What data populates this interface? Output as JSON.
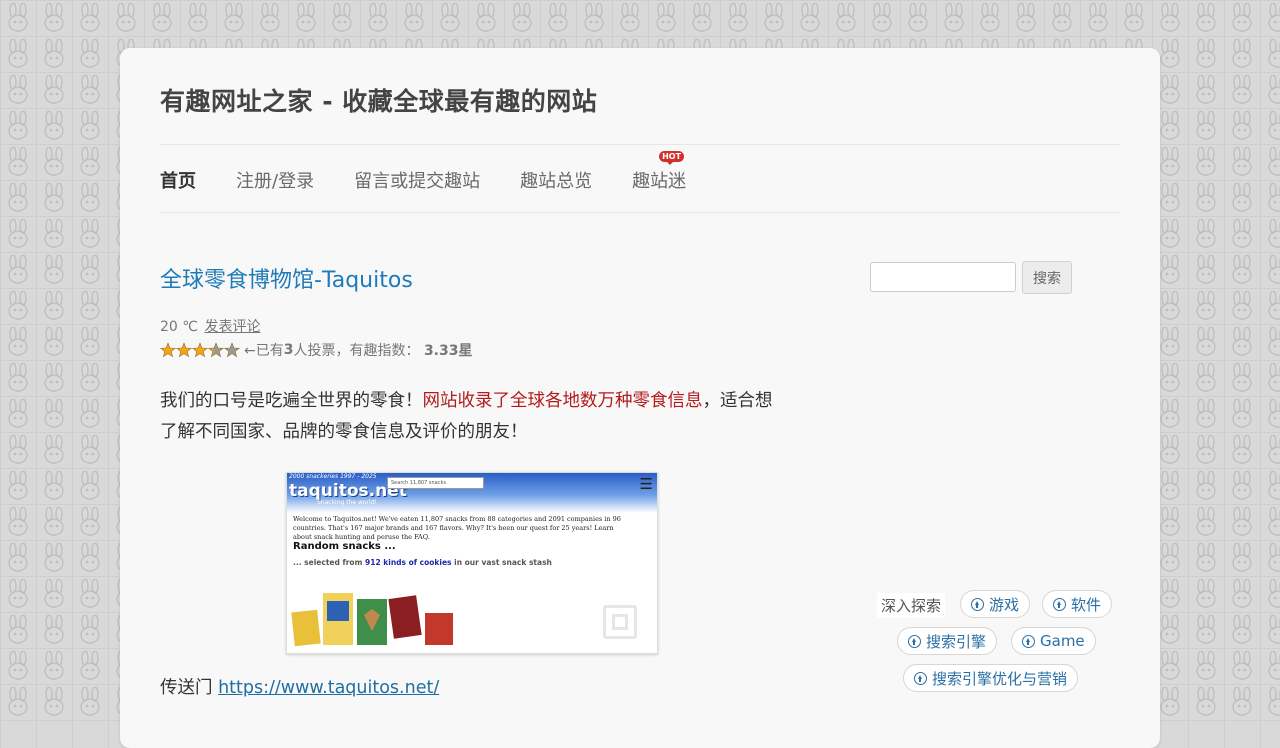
{
  "site": {
    "title": "有趣网址之家 - 收藏全球最有趣的网站"
  },
  "nav": {
    "items": [
      "首页",
      "注册/登录",
      "留言或提交趣站",
      "趣站总览",
      "趣站迷"
    ],
    "hot_badge": "HOT"
  },
  "post": {
    "title": "全球零食博物馆-Taquitos",
    "temperature": "20 ℃",
    "comment_link": "发表评论",
    "rating": {
      "stars_value": 3.33,
      "stars_max": 5,
      "votes_prefix": "←已有",
      "votes_count": "3",
      "votes_suffix": " 人投票，有趣指数：",
      "score": "3.33星"
    },
    "text_before": "我们的口号是吃遍全世界的零食！",
    "text_highlight": "网站收录了全球各地数万种零食信息",
    "text_after": "，适合想了解不同国家、品牌的零食信息及评价的朋友！",
    "screenshot": {
      "topline": "2000 snackeries 1997 - 2025",
      "logo": "taquitos.net",
      "tagline": "Snacking the world!",
      "search_placeholder": "Search 11,807 snacks",
      "welcome_text": "Welcome to Taquitos.net! We've eaten 11,807 snacks from 88 categories and 2091 companies in 96 countries. That's 167 major brands and 167 flavors. Why? It's been our quest for 25 years! Learn about snack hunting and peruse the FAQ.",
      "random_heading": "Random snacks ...",
      "selected_prefix": "... selected from ",
      "selected_highlight": "912 kinds of cookies",
      "selected_suffix": " in our vast snack stash"
    },
    "portal_label": "传送门 ",
    "portal_url": "https://www.taquitos.net/"
  },
  "sidebar": {
    "search_button": "搜索",
    "explore_label": "深入探索",
    "tags": [
      "游戏",
      "软件",
      "搜索引擎",
      "Game",
      "搜索引擎优化与营销"
    ]
  },
  "colors": {
    "link": "#1e7bb8",
    "highlight": "#b31b1b",
    "hot": "#d0312d"
  }
}
